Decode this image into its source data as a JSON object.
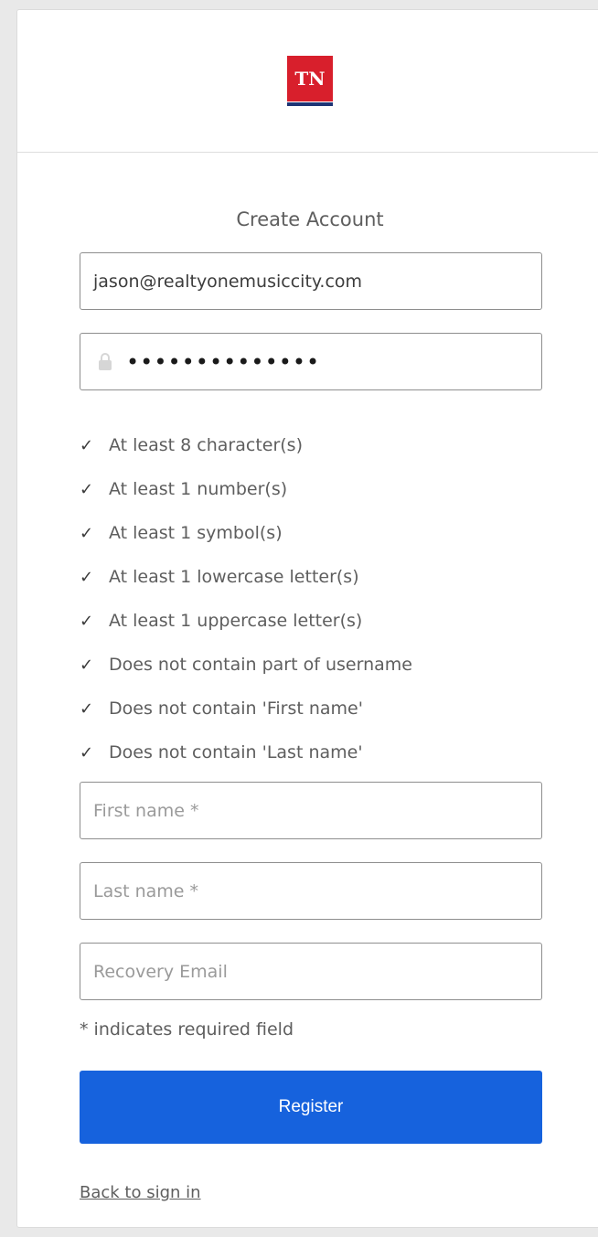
{
  "logo": {
    "text": "TN",
    "brand_color": "#d81f2c",
    "stripe_color": "#1e3575"
  },
  "form": {
    "title": "Create Account",
    "username": {
      "value": "jason@realtyonemusiccity.com"
    },
    "password": {
      "value": "••••••••••••••",
      "icon": "lock-icon"
    },
    "password_rules": [
      {
        "label": "At least 8 character(s)",
        "met": true
      },
      {
        "label": "At least 1 number(s)",
        "met": true
      },
      {
        "label": "At least 1 symbol(s)",
        "met": true
      },
      {
        "label": "At least 1 lowercase letter(s)",
        "met": true
      },
      {
        "label": "At least 1 uppercase letter(s)",
        "met": true
      },
      {
        "label": "Does not contain part of username",
        "met": true
      },
      {
        "label": "Does not contain 'First name'",
        "met": true
      },
      {
        "label": "Does not contain 'Last name'",
        "met": true
      }
    ],
    "first_name": {
      "placeholder": "First name *",
      "value": ""
    },
    "last_name": {
      "placeholder": "Last name *",
      "value": ""
    },
    "recovery_email": {
      "placeholder": "Recovery Email",
      "value": ""
    },
    "required_note": "* indicates required field",
    "register_label": "Register",
    "register_color": "#1662dd",
    "back_link": "Back to sign in"
  }
}
